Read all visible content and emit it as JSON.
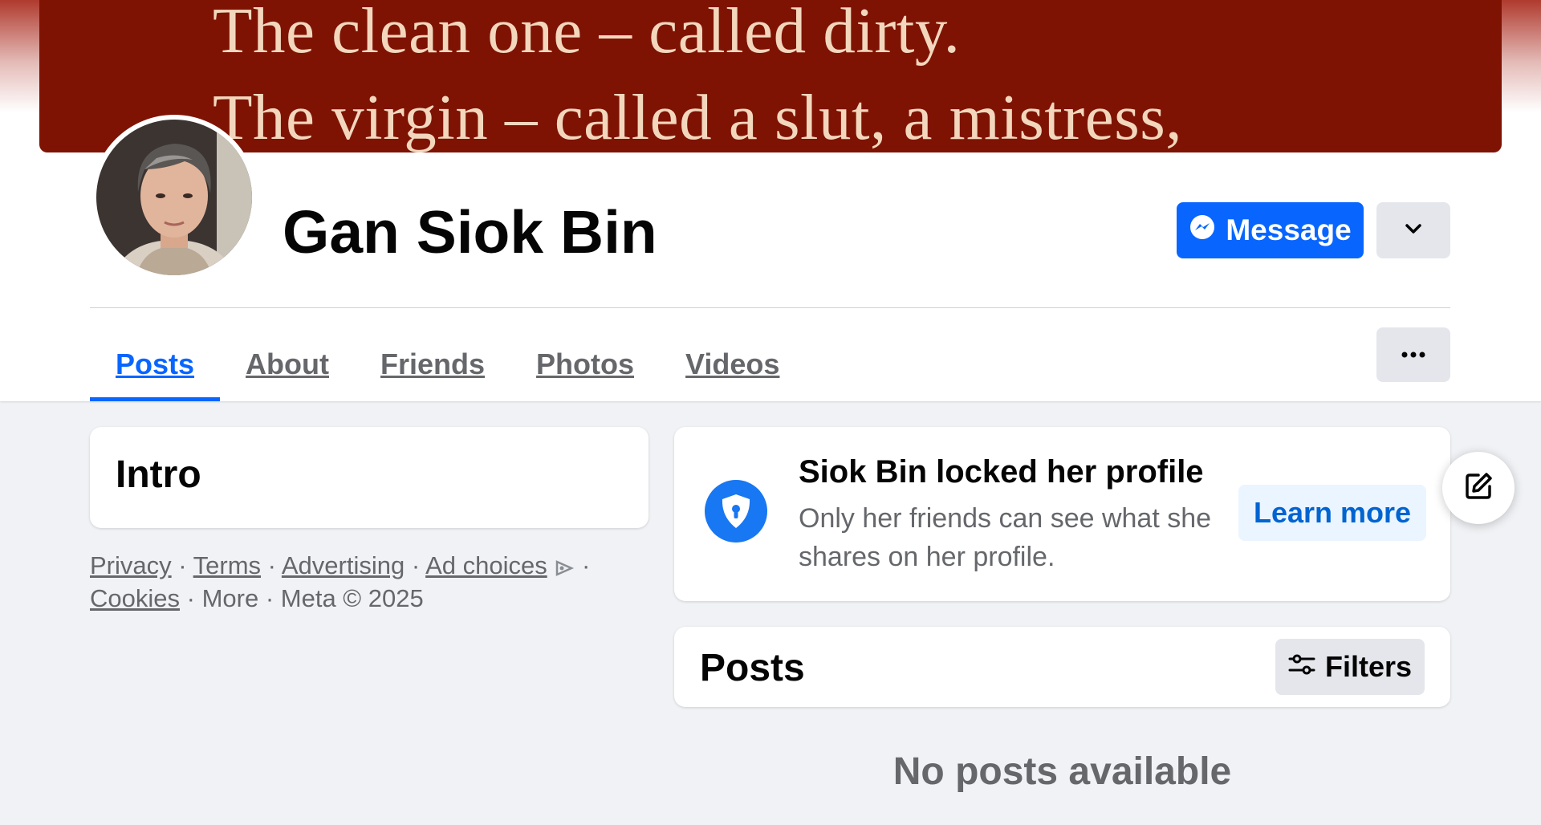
{
  "cover": {
    "line1": "The clean one – called dirty.",
    "line2": "The virgin – called a slut, a mistress,"
  },
  "profile": {
    "name": "Gan Siok Bin",
    "message_label": "Message"
  },
  "tabs": [
    {
      "label": "Posts",
      "active": true
    },
    {
      "label": "About"
    },
    {
      "label": "Friends"
    },
    {
      "label": "Photos"
    },
    {
      "label": "Videos"
    }
  ],
  "intro": {
    "title": "Intro"
  },
  "footer": {
    "privacy": "Privacy",
    "terms": "Terms",
    "advertising": "Advertising",
    "ad_choices": "Ad choices",
    "cookies": "Cookies",
    "more": "More",
    "meta": "Meta © 2025"
  },
  "lock_notice": {
    "title": "Siok Bin locked her profile",
    "text": "Only her friends can see what she shares on her profile.",
    "learn_more": "Learn more"
  },
  "posts": {
    "title": "Posts",
    "filters_label": "Filters",
    "empty": "No posts available"
  },
  "colors": {
    "accent": "#0866ff",
    "cover": "#7e1304",
    "background": "#f0f2f5"
  }
}
